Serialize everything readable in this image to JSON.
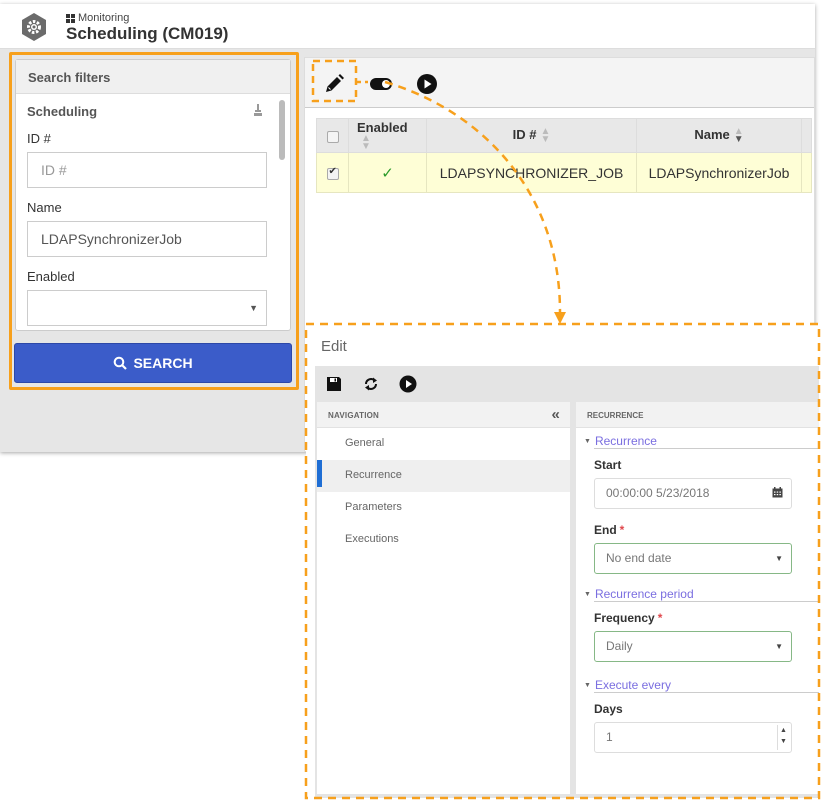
{
  "app": {
    "breadcrumb": "Monitoring",
    "title": "Scheduling (CM019)"
  },
  "filters": {
    "header": "Search filters",
    "section": "Scheduling",
    "id_label": "ID #",
    "id_placeholder": "ID #",
    "name_label": "Name",
    "name_value": "LDAPSynchronizerJob",
    "enabled_label": "Enabled",
    "enabled_value": "",
    "search_button": "SEARCH"
  },
  "grid": {
    "toolbar": [
      "edit-icon",
      "toggle-icon",
      "play-icon"
    ],
    "columns": [
      "Enabled",
      "ID #",
      "Name"
    ],
    "rows": [
      {
        "selected": true,
        "enabled": "✓",
        "id": "LDAPSYNCHRONIZER_JOB",
        "name": "LDAPSynchronizerJob"
      }
    ]
  },
  "edit": {
    "title": "Edit",
    "toolbar": [
      "save-icon",
      "refresh-icon",
      "play-icon"
    ],
    "nav_header": "NAVIGATION",
    "nav_items": [
      "General",
      "Recurrence",
      "Parameters",
      "Executions"
    ],
    "active_nav": "Recurrence",
    "content_header": "RECURRENCE",
    "groups": {
      "recurrence": "Recurrence",
      "recurrence_period": "Recurrence period",
      "execute_every": "Execute every"
    },
    "fields": {
      "start_label": "Start",
      "start_value": "00:00:00 5/23/2018",
      "end_label": "End",
      "end_value": "No end date",
      "frequency_label": "Frequency",
      "frequency_value": "Daily",
      "days_label": "Days",
      "days_value": "1",
      "required_mark": "*"
    }
  },
  "colors": {
    "highlight": "#f7a01c",
    "search_button": "#3b5cc9",
    "selected_row": "#fefed6",
    "group_link": "#7a6ee0",
    "active_nav": "#1f6ed4"
  }
}
